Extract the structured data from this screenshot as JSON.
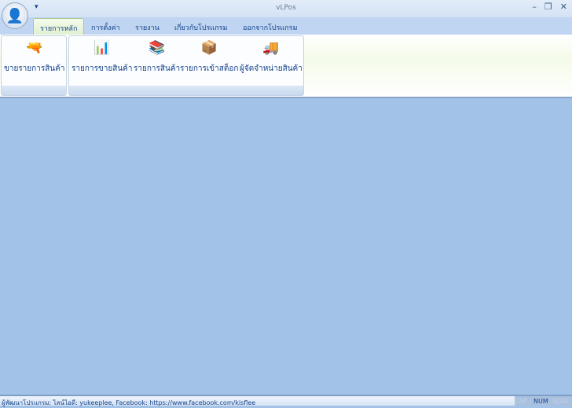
{
  "window": {
    "title": "vLPos",
    "qat_icon": "dropdown-arrow-icon",
    "minimize": "minimize-icon",
    "restore": "restore-icon",
    "close": "close-icon"
  },
  "app_menu": {
    "icon": "user-avatar-icon"
  },
  "tabs": [
    {
      "label": "รายการหลัก",
      "active": true
    },
    {
      "label": "การตั้งค่า"
    },
    {
      "label": "รายงาน"
    },
    {
      "label": "เกี่ยวกับโปรแกรม"
    },
    {
      "label": "ออกจากโปรแกรม"
    }
  ],
  "groups": [
    {
      "buttons": [
        {
          "label": "ขายรายการสินค้า",
          "icon": "barcode-scanner-icon"
        }
      ]
    },
    {
      "buttons": [
        {
          "label": "รายการขายสินค้า",
          "icon": "presentation-chart-icon"
        },
        {
          "label": "รายการสินค้า",
          "icon": "folder-books-icon"
        },
        {
          "label": "รายการเข้าสต็อก",
          "icon": "box-icon"
        },
        {
          "label": "ผู้จัดจำหน่ายสินค้า",
          "icon": "truck-icon"
        }
      ]
    }
  ],
  "status": {
    "text": "ผู้พัฒนาโปรแกรม: ไลน์ไอดี: yukeeplee, Facebook: https://www.facebook.com/kisflee",
    "cap": "CAP",
    "num": "NUM",
    "scrl": "SCRL"
  }
}
